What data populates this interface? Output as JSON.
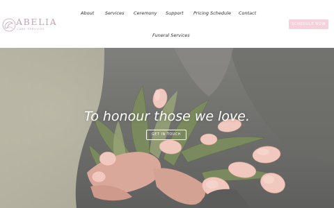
{
  "brand": {
    "name": "ABELIA",
    "tagline": "CARE SERVICES"
  },
  "nav": {
    "about": "About",
    "services": "Services",
    "ceremony": "Ceremony",
    "support": "Support",
    "pricing": "Pricing Schedule",
    "contact": "Contact",
    "funeral": "Funeral Services"
  },
  "cta": {
    "label": "SCHEDULE NOW"
  },
  "hero": {
    "headline": "To honour those we love.",
    "button_label": "GET IN TOUCH"
  },
  "colors": {
    "brand_pink": "#c79fb4",
    "cta_bg": "#f6d0db",
    "nav_text": "#2f2f2f"
  }
}
